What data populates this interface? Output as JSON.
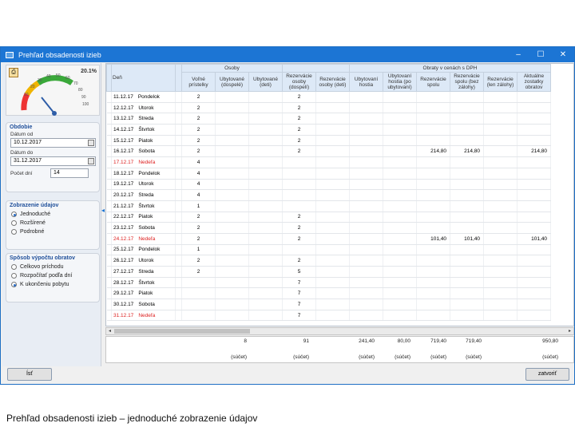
{
  "window": {
    "title": "Prehľad obsadenosti izieb"
  },
  "gauge": {
    "percent": "20.1%",
    "ticks": [
      "10",
      "20",
      "30",
      "40",
      "50",
      "60",
      "70",
      "80",
      "90",
      "100"
    ]
  },
  "left": {
    "obdobie": {
      "title": "Obdobie",
      "from_label": "Dátum od",
      "from_value": "10.12.2017",
      "to_label": "Dátum do",
      "to_value": "31.12.2017",
      "days_label": "Počet dní",
      "days_value": "14"
    },
    "zobrazenie": {
      "title": "Zobrazenie údajov",
      "options": [
        "Jednoduché",
        "Rozšírené",
        "Podrobné"
      ],
      "selected": 0
    },
    "vypocet": {
      "title": "Spôsob výpočtu obratov",
      "options": [
        "Celkovo príchodu",
        "Rozpočítať podľa dní",
        "K ukončeniu pobytu"
      ],
      "selected": 2
    }
  },
  "grid": {
    "group_headers": [
      "Osoby",
      "Obraty v cenách s DPH"
    ],
    "headers": [
      "Deň",
      "Voľné prístelky",
      "Ubytované (dospelé)",
      "Ubytované (deti)",
      "Rezervácie osoby (dospelí)",
      "Rezervácie osoby (deti)",
      "Ubytovaní hostia",
      "Ubytovaní hostia (po ubytovaní)",
      "Rezervácie spolu",
      "Rezervácie spolu (bez zálohy)",
      "Rezervácie (len zálohy)",
      "Aktuálne zostatky obratov"
    ],
    "rows": [
      {
        "date": "11.12.17",
        "day": "Pondelok",
        "c1": "2",
        "c4": "2",
        "red": false
      },
      {
        "date": "12.12.17",
        "day": "Utorok",
        "c1": "2",
        "c4": "2",
        "red": false
      },
      {
        "date": "13.12.17",
        "day": "Streda",
        "c1": "2",
        "c4": "2",
        "red": false
      },
      {
        "date": "14.12.17",
        "day": "Štvrtok",
        "c1": "2",
        "c4": "2",
        "red": false
      },
      {
        "date": "15.12.17",
        "day": "Piatok",
        "c1": "2",
        "c4": "2",
        "red": false
      },
      {
        "date": "16.12.17",
        "day": "Sobota",
        "c1": "2",
        "c4": "2",
        "v8": "214,80",
        "v9": "214,80",
        "v11": "214,80",
        "red": false
      },
      {
        "date": "17.12.17",
        "day": "Nedeľa",
        "c1": "4",
        "red": true
      },
      {
        "date": "18.12.17",
        "day": "Pondelok",
        "c1": "4",
        "red": false
      },
      {
        "date": "19.12.17",
        "day": "Utorok",
        "c1": "4",
        "red": false
      },
      {
        "date": "20.12.17",
        "day": "Streda",
        "c1": "4",
        "red": false
      },
      {
        "date": "21.12.17",
        "day": "Štvrtok",
        "c1": "1",
        "red": false
      },
      {
        "date": "22.12.17",
        "day": "Piatok",
        "c1": "2",
        "c4": "2",
        "red": false
      },
      {
        "date": "23.12.17",
        "day": "Sobota",
        "c1": "2",
        "c4": "2",
        "red": false
      },
      {
        "date": "24.12.17",
        "day": "Nedeľa",
        "c1": "2",
        "c4": "2",
        "v8": "101,40",
        "v9": "101,40",
        "v11": "101,40",
        "red": true
      },
      {
        "date": "25.12.17",
        "day": "Pondelok",
        "c1": "1",
        "red": false
      },
      {
        "date": "26.12.17",
        "day": "Utorok",
        "c1": "2",
        "c4": "2",
        "red": false
      },
      {
        "date": "27.12.17",
        "day": "Streda",
        "c1": "2",
        "c4": "5",
        "red": false
      },
      {
        "date": "28.12.17",
        "day": "Štvrtok",
        "c4": "7",
        "red": false
      },
      {
        "date": "29.12.17",
        "day": "Piatok",
        "c4": "7",
        "red": false
      },
      {
        "date": "30.12.17",
        "day": "Sobota",
        "c4": "7",
        "red": false
      },
      {
        "date": "31.12.17",
        "day": "Nedeľa",
        "c4": "7",
        "red": true
      }
    ]
  },
  "totals": {
    "values": [
      "8",
      "91",
      "241,40",
      "80,00",
      "719,40",
      "719,40",
      "950,80"
    ],
    "sub": "(súčet)"
  },
  "buttons": {
    "left": "Ísť",
    "right": "zatvoriť"
  },
  "caption": "Prehľad obsadenosti izieb – jednoduché zobrazenie údajov"
}
